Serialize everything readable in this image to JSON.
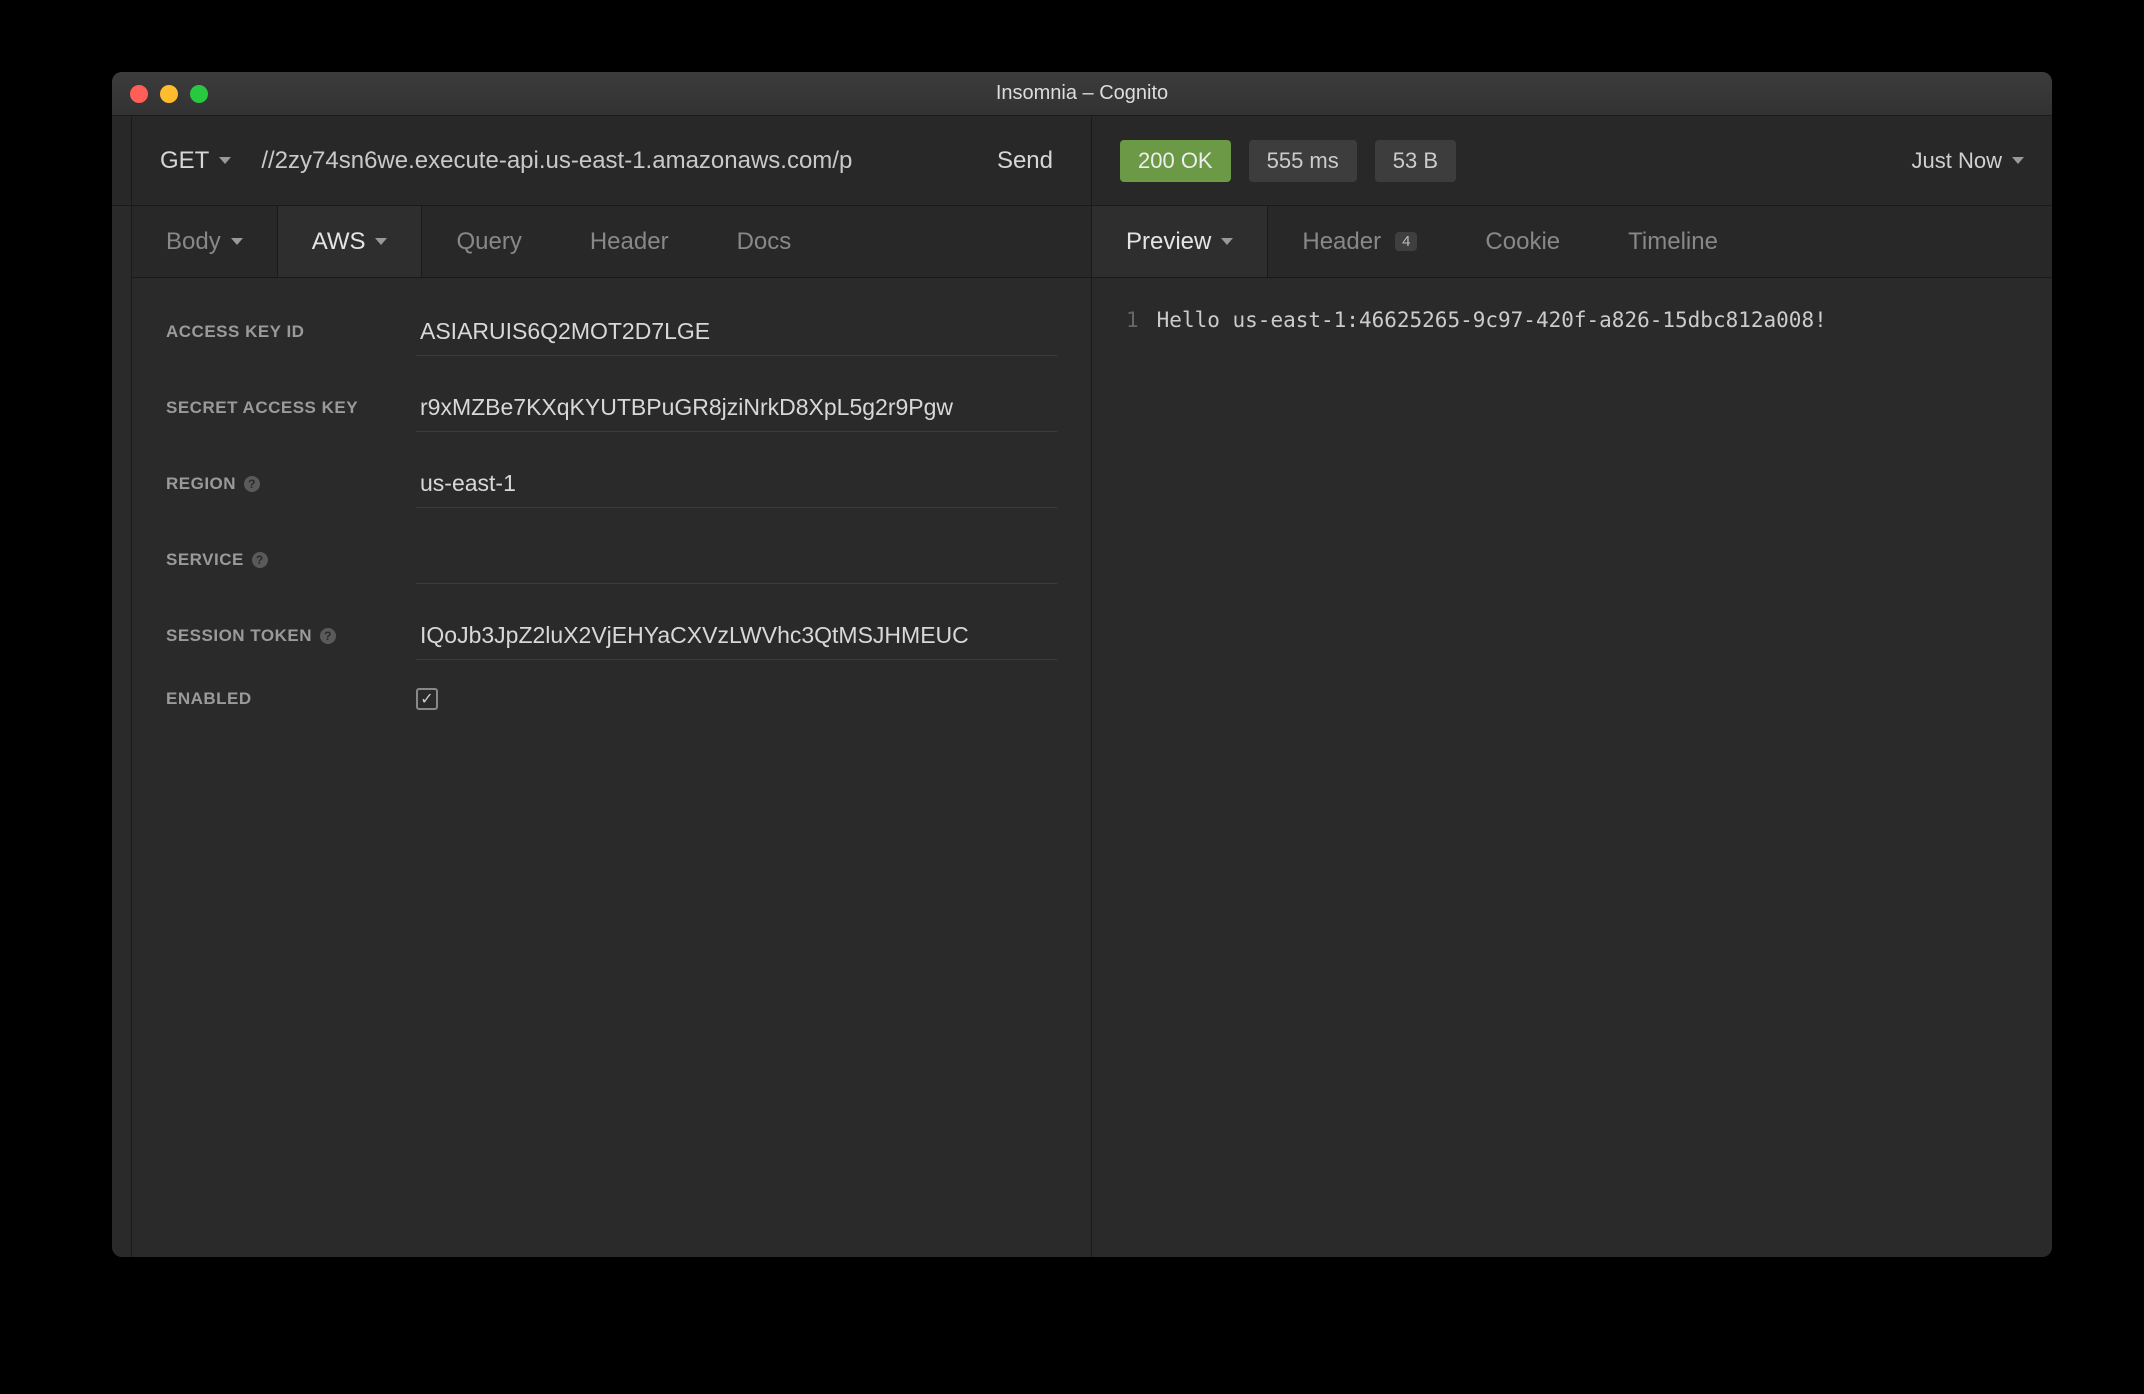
{
  "window": {
    "title": "Insomnia – Cognito"
  },
  "request": {
    "method": "GET",
    "url": "//2zy74sn6we.execute-api.us-east-1.amazonaws.com/p",
    "send_label": "Send"
  },
  "response_meta": {
    "status": "200 OK",
    "time": "555 ms",
    "size": "53 B",
    "history_label": "Just Now"
  },
  "left_tabs": {
    "body": "Body",
    "auth": "AWS",
    "query": "Query",
    "header": "Header",
    "docs": "Docs"
  },
  "aws_form": {
    "access_key_id": {
      "label": "ACCESS KEY ID",
      "value": "ASIARUIS6Q2MOT2D7LGE"
    },
    "secret_access_key": {
      "label": "SECRET ACCESS KEY",
      "value": "r9xMZBe7KXqKYUTBPuGR8jziNrkD8XpL5g2r9Pgw"
    },
    "region": {
      "label": "REGION",
      "value": "us-east-1"
    },
    "service": {
      "label": "SERVICE",
      "value": ""
    },
    "session_token": {
      "label": "SESSION TOKEN",
      "value": "IQoJb3JpZ2luX2VjEHYaCXVzLWVhc3QtMSJHMEUC"
    },
    "enabled": {
      "label": "ENABLED",
      "checked": true
    }
  },
  "right_tabs": {
    "preview": "Preview",
    "header": "Header",
    "header_badge": "4",
    "cookie": "Cookie",
    "timeline": "Timeline"
  },
  "response_body": {
    "line_number": "1",
    "text": "Hello us-east-1:46625265-9c97-420f-a826-15dbc812a008!"
  }
}
